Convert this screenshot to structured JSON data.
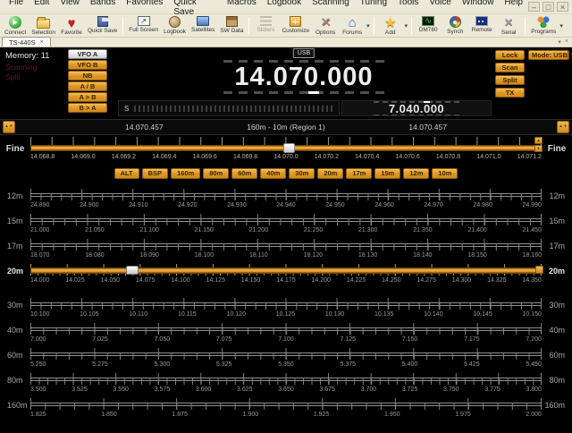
{
  "menu": {
    "items": [
      "File",
      "Edit",
      "View",
      "Bands",
      "Favorites",
      "Quick Save",
      "Macros",
      "Logbook",
      "Scanning",
      "Tuning",
      "Tools",
      "Voice",
      "Window",
      "Help"
    ]
  },
  "window_controls": {
    "minimize": "–",
    "restore": "□",
    "close": "×"
  },
  "toolbar": {
    "items": [
      {
        "label": "Connect",
        "icon": "connect-icon"
      },
      {
        "label": "Selection",
        "icon": "folder-icon"
      },
      {
        "label": "Favorite",
        "icon": "heart-icon"
      },
      {
        "label": "Quick Save",
        "icon": "floppy-icon",
        "sep_after": true
      },
      {
        "label": "Full Screen",
        "icon": "fullscreen-icon"
      },
      {
        "label": "Logbook",
        "icon": "logbook-icon"
      },
      {
        "label": "Satellites",
        "icon": "satellites-icon"
      },
      {
        "label": "SW Data",
        "icon": "swdata-icon",
        "sep_after": true
      },
      {
        "label": "Sliders",
        "icon": "sliders-icon",
        "disabled": true
      },
      {
        "label": "Customize",
        "icon": "customize-icon"
      },
      {
        "label": "Options",
        "icon": "options-icon"
      },
      {
        "label": "Forums",
        "icon": "forums-icon",
        "dropdown": true,
        "sep_after": true
      },
      {
        "label": "Add",
        "icon": "add-icon",
        "dropdown": true,
        "sep_after": true
      },
      {
        "label": "DM780",
        "icon": "dm780-icon"
      },
      {
        "label": "Synch",
        "icon": "synch-icon"
      },
      {
        "label": "Remote",
        "icon": "remote-icon"
      },
      {
        "label": "Serial",
        "icon": "serial-icon",
        "sep_after": true
      },
      {
        "label": "Programs",
        "icon": "programs-icon",
        "dropdown": true
      }
    ]
  },
  "tab": {
    "label": "TS-440S",
    "close": "×"
  },
  "tabrow_controls": {
    "scroll": "▾",
    "close": "×"
  },
  "radio": {
    "memory_label": "Memory: 11",
    "annunciators": [
      "Scanning",
      "Split"
    ],
    "vfo_buttons": [
      {
        "label": "VFO A",
        "active": true
      },
      {
        "label": "VFO B",
        "active": false
      },
      {
        "label": "NB",
        "active": false
      },
      {
        "label": "A / B",
        "active": false
      },
      {
        "label": "A > B",
        "active": false
      },
      {
        "label": "B > A",
        "active": false
      }
    ],
    "mode_badge": "USB",
    "main_frequency": "14.070.000",
    "sub_frequency": "7.040.000",
    "smeter_label": "S",
    "right_buttons": [
      "Lock",
      "Scan",
      "Split",
      "TX"
    ],
    "mode_button": {
      "label": "Mode: USB",
      "arrow": "▾"
    }
  },
  "band_header": {
    "left_freq": "14.070.457",
    "center": "160m - 10m (Region 1)",
    "right_freq": "14.070.457",
    "stepper": "▲\n▼"
  },
  "fine": {
    "label": "Fine",
    "tick_labels": [
      "14.068.8",
      "14.069.0",
      "14.069.2",
      "14.069.4",
      "14.069.6",
      "14.069.8",
      "14.070.0",
      "14.070.2",
      "14.070.4",
      "14.070.6",
      "14.070.8",
      "14.071.0",
      "14.071.2"
    ],
    "thumb_fraction": 0.506
  },
  "band_buttons": [
    "ALT",
    "BSP",
    "160m",
    "80m",
    "60m",
    "40m",
    "30m",
    "20m",
    "17m",
    "15m",
    "12m",
    "10m"
  ],
  "bands": [
    {
      "name": "12m",
      "selected": false,
      "labels": [
        "24.890",
        "24.900",
        "24.910",
        "24.920",
        "24.930",
        "24.940",
        "24.950",
        "24.960",
        "24.970",
        "24.980",
        "24.990"
      ]
    },
    {
      "name": "15m",
      "selected": false,
      "labels": [
        "21.000",
        "21.050",
        "21.100",
        "21.150",
        "21.200",
        "21.250",
        "21.300",
        "21.350",
        "21.400",
        "21.450"
      ]
    },
    {
      "name": "17m",
      "selected": false,
      "labels": [
        "18.070",
        "18.080",
        "18.090",
        "18.100",
        "18.110",
        "18.120",
        "18.130",
        "18.140",
        "18.150",
        "18.160"
      ]
    },
    {
      "name": "20m",
      "selected": true,
      "thumb_fraction": 0.2,
      "labels": [
        "14.000",
        "14.025",
        "14.050",
        "14.075",
        "14.100",
        "14.125",
        "14.150",
        "14.175",
        "14.200",
        "14.225",
        "14.250",
        "14.275",
        "14.300",
        "14.325",
        "14.350"
      ]
    },
    {
      "name": "30m",
      "selected": false,
      "labels": [
        "10.100",
        "10.105",
        "10.110",
        "10.115",
        "10.120",
        "10.125",
        "10.130",
        "10.135",
        "10.140",
        "10.145",
        "10.150"
      ]
    },
    {
      "name": "40m",
      "selected": false,
      "labels": [
        "7.000",
        "7.025",
        "7.050",
        "7.075",
        "7.100",
        "7.125",
        "7.150",
        "7.175",
        "7.200"
      ]
    },
    {
      "name": "60m",
      "selected": false,
      "labels": [
        "5.250",
        "5.275",
        "5.300",
        "5.325",
        "5.350",
        "5.375",
        "5.400",
        "5.425",
        "5.450"
      ]
    },
    {
      "name": "80m",
      "selected": false,
      "labels": [
        "3.500",
        "3.525",
        "3.550",
        "3.575",
        "3.600",
        "3.625",
        "3.650",
        "3.675",
        "3.700",
        "3.725",
        "3.750",
        "3.775",
        "3.800"
      ]
    },
    {
      "name": "160m",
      "selected": false,
      "labels": [
        "1.825",
        "1.850",
        "1.875",
        "1.900",
        "1.925",
        "1.950",
        "1.975",
        "2.000"
      ]
    }
  ]
}
